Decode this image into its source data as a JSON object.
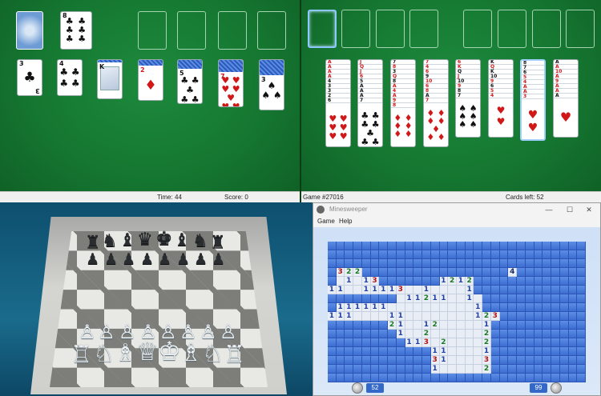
{
  "solitaire": {
    "status": {
      "time_label": "Time:",
      "time_value": "44",
      "score_label": "Score: 0"
    }
  },
  "spider": {
    "status": {
      "game": "Game #27016",
      "cards_left": "Cards left: 52"
    }
  },
  "chess": {},
  "minesweeper": {
    "title": "Minesweeper",
    "menu": [
      "Game",
      "Help"
    ],
    "mines_left": "52",
    "timer": "99"
  },
  "colors": {
    "felt": "#157731",
    "red_suit": "#d01818",
    "mine_tile": "#3c6dd1",
    "revealed_tile": "#e9eef6"
  }
}
